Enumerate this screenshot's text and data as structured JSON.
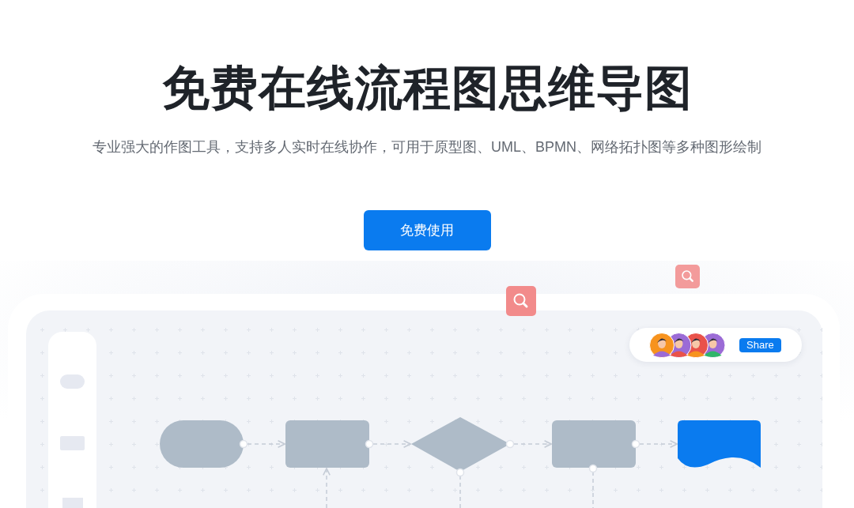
{
  "hero": {
    "title": "免费在线流程图思维导图",
    "subtitle": "专业强大的作图工具，支持多人实时在线协作，可用于原型图、UML、BPMN、网络拓扑图等多种图形绘制",
    "cta": "免费使用"
  },
  "collaborators": {
    "share": "Share"
  }
}
